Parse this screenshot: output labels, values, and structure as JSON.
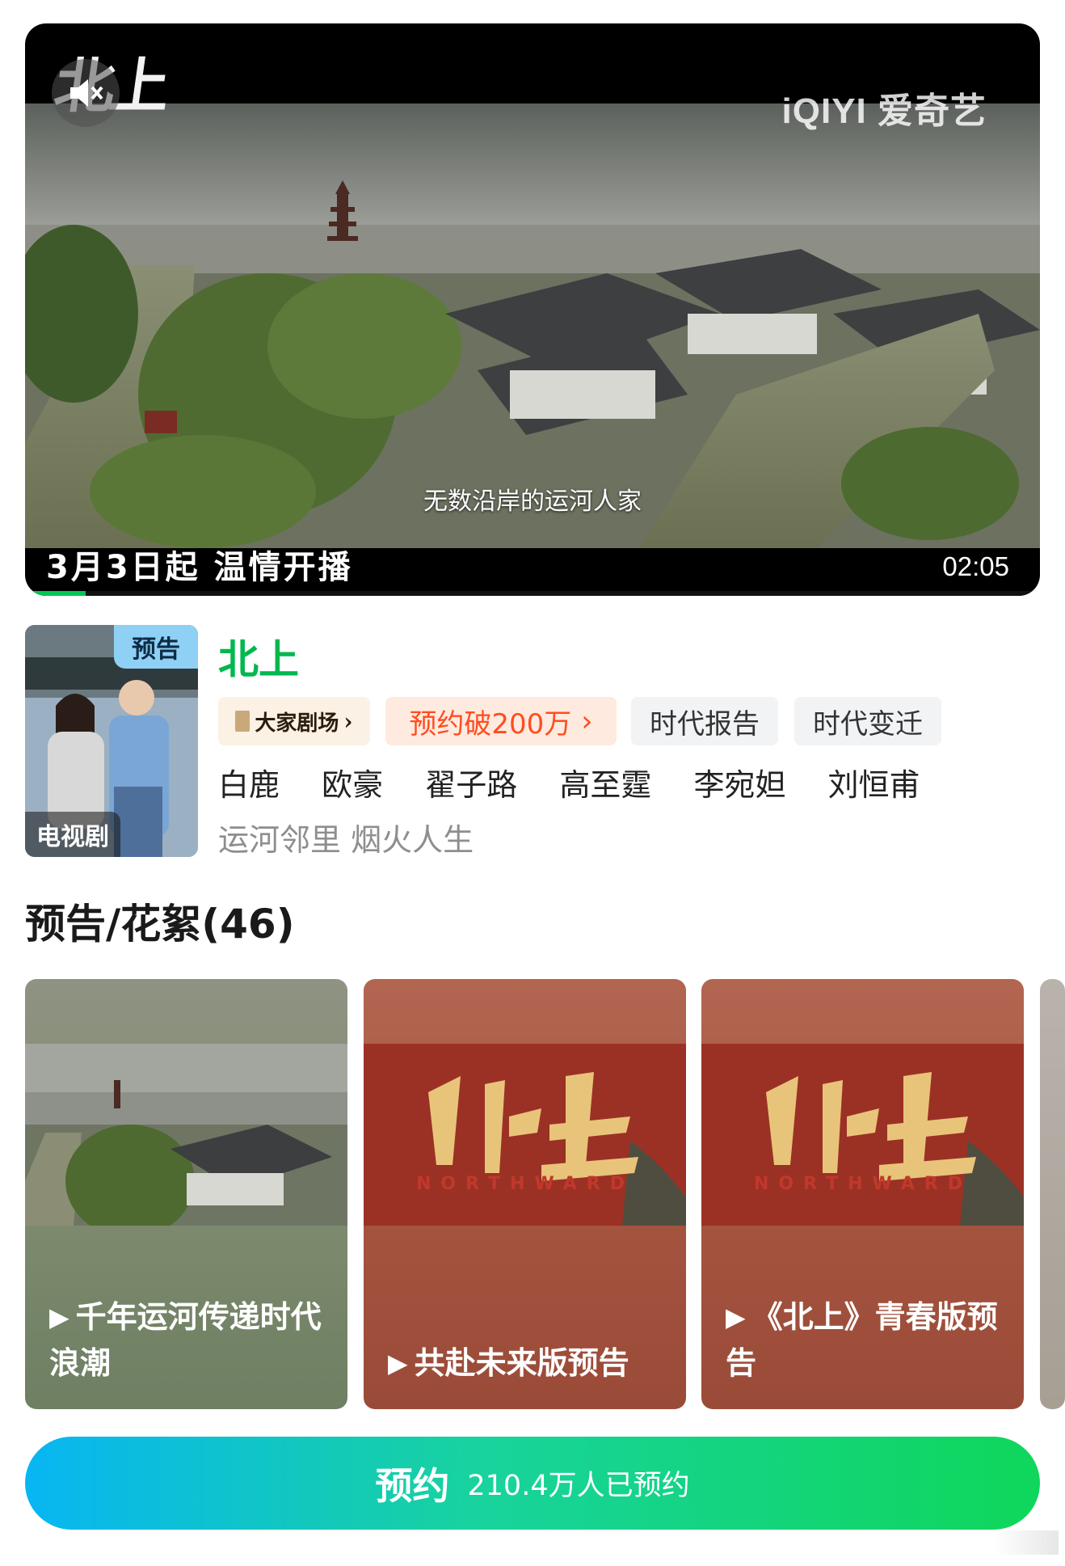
{
  "player": {
    "title_logo": "北上",
    "watermark": "iQIYI 爱奇艺",
    "subtitle": "无数沿岸的运河人家",
    "caption": "3月3日起 温情开播",
    "duration": "02:05",
    "progress": 0.06,
    "icons": {
      "mute": "speaker-muted-icon"
    }
  },
  "show": {
    "poster_badge": "预告",
    "poster_type": "电视剧",
    "title": "北上",
    "tags": {
      "theater": "大家剧场",
      "reserve": "预约破200万",
      "tag1": "时代报告",
      "tag2": "时代变迁"
    },
    "cast": [
      "白鹿",
      "欧豪",
      "翟子路",
      "高至霆",
      "李宛妲",
      "刘恒甫"
    ],
    "slogan": "运河邻里 烟火人生"
  },
  "section": {
    "title": "预告/花絮(46)"
  },
  "clips": [
    {
      "title": "千年运河传递时代浪潮"
    },
    {
      "title": "共赴未来版预告"
    },
    {
      "title": "《北上》青春版预告"
    }
  ],
  "reserve_bar": {
    "label": "预约",
    "count": "210.4万人已预约"
  },
  "colors": {
    "brand_green": "#00b84f",
    "reserve_orange": "#ff4d1f",
    "progress_green": "#00c656"
  }
}
